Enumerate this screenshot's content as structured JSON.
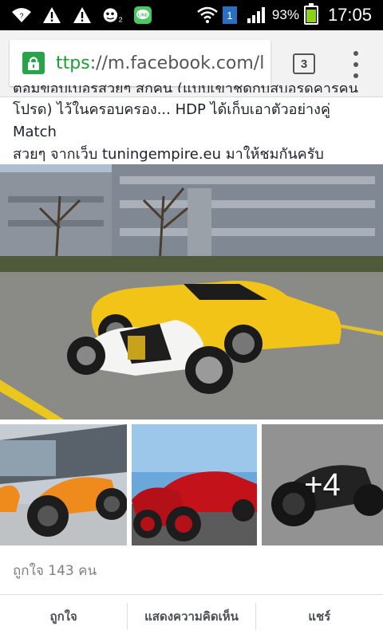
{
  "status_bar": {
    "battery_percent": "93%",
    "time": "17:05",
    "sim_number": "1",
    "notification_icons": [
      "wifi-icon",
      "warning-icon",
      "warning-icon",
      "mascot-icon",
      "line-app-icon"
    ]
  },
  "browser": {
    "url_scheme": "ttps",
    "url_rest": "://m.facebook.com/l",
    "tab_count": "3"
  },
  "post": {
    "text_lines": [
      "ตอมขอบเบอรสวยๆ สกคน (แบบเขาชุดกบสบอรดคารคน",
      "โปรด) ไว้ในครอบครอง... HDP ได้เก็บเอาตัวอย่างคู่ Match",
      "สวยๆ จากเว็บ tuningempire.eu มาให้ชมกันครับ"
    ],
    "more_photos": "+4"
  },
  "reactions": {
    "likes_text": "ถูกใจ 143 คน"
  },
  "actions": {
    "like": "ถูกใจ",
    "comment": "แสดงความคิดเห็น",
    "share": "แชร์"
  },
  "colors": {
    "lock_green": "#27a34a",
    "scheme_green": "#1aa12f",
    "car_yellow": "#f2c418",
    "text_dark": "#1d2129"
  }
}
